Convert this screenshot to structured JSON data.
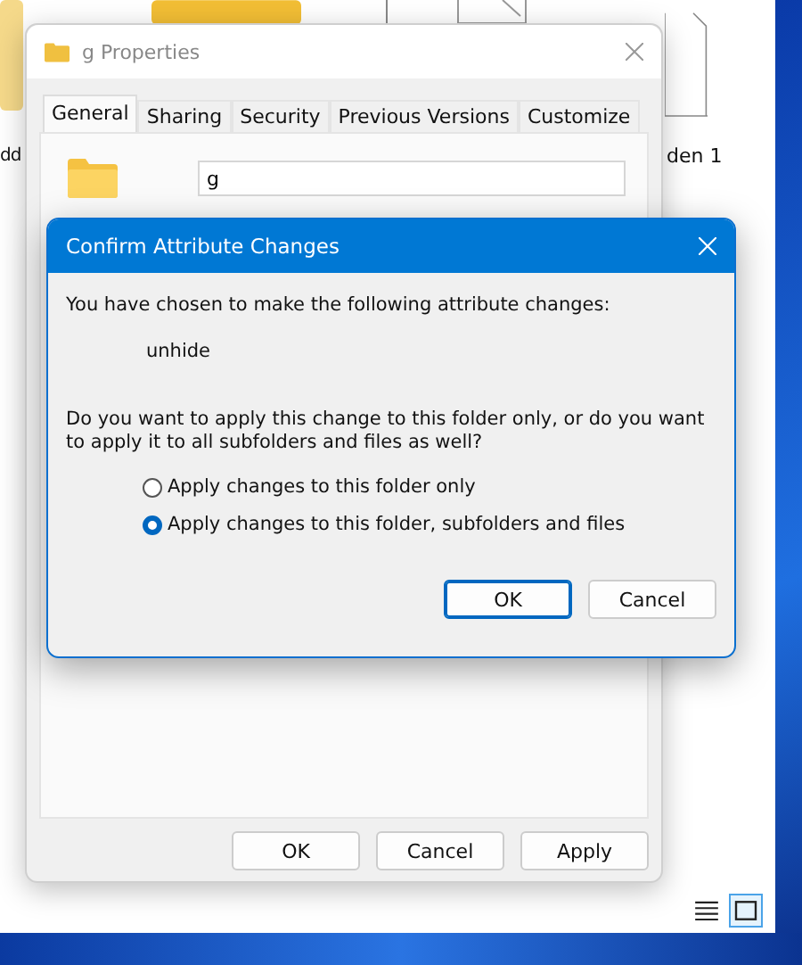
{
  "explorer": {
    "item_labels": [
      "dd",
      "den 1"
    ],
    "view_buttons": [
      {
        "kind": "details",
        "selected": false
      },
      {
        "kind": "tiles",
        "selected": true
      }
    ]
  },
  "properties": {
    "title": "g Properties",
    "tabs": [
      {
        "label": "General",
        "selected": true
      },
      {
        "label": "Sharing",
        "selected": false
      },
      {
        "label": "Security",
        "selected": false
      },
      {
        "label": "Previous Versions",
        "selected": false
      },
      {
        "label": "Customize",
        "selected": false
      }
    ],
    "name_value": "g",
    "buttons": [
      "OK",
      "Cancel",
      "Apply"
    ]
  },
  "dialog": {
    "title": "Confirm Attribute Changes",
    "intro": "You have chosen to make the following attribute changes:",
    "change": "unhide",
    "question": "Do you want to apply this change to this folder only, or do you want to apply it to all subfolders and files as well?",
    "options": [
      {
        "label": "Apply changes to this folder only",
        "selected": false
      },
      {
        "label": "Apply changes to this folder, subfolders and files",
        "selected": true
      }
    ],
    "buttons": [
      {
        "label": "OK",
        "default": true
      },
      {
        "label": "Cancel",
        "default": false
      }
    ]
  }
}
